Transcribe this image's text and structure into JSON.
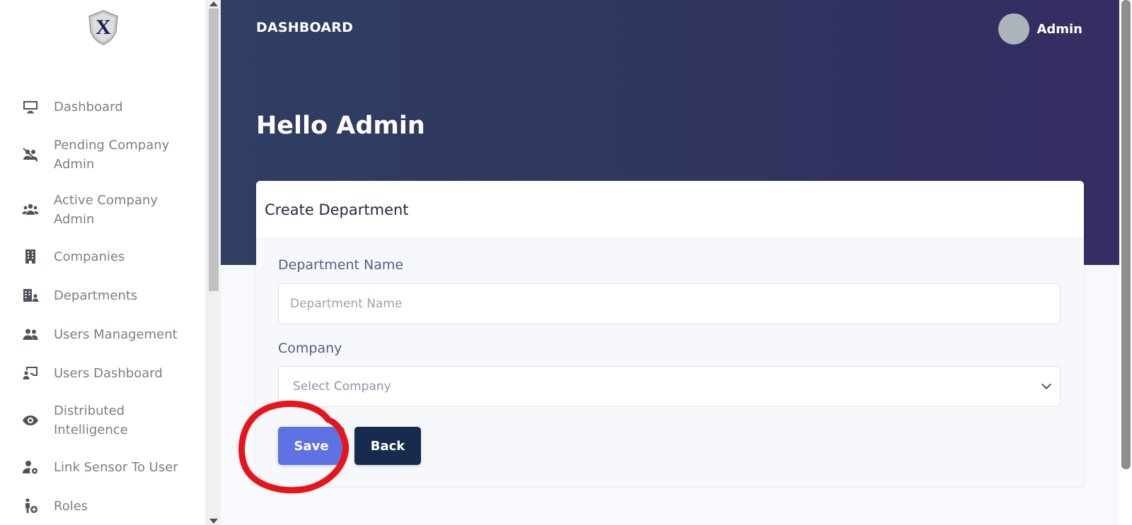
{
  "sidebar": {
    "logo_icon": "shield-x-logo",
    "items": [
      {
        "label": "Dashboard",
        "icon": "monitor-icon"
      },
      {
        "label": "Pending Company Admin",
        "icon": "users-slash-icon"
      },
      {
        "label": "Active Company Admin",
        "icon": "users-icon"
      },
      {
        "label": "Companies",
        "icon": "building-icon"
      },
      {
        "label": "Departments",
        "icon": "building-user-icon"
      },
      {
        "label": "Users Management",
        "icon": "user-group-icon"
      },
      {
        "label": "Users Dashboard",
        "icon": "chalkboard-user-icon"
      },
      {
        "label": "Distributed Intelligence",
        "icon": "eye-icon"
      },
      {
        "label": "Link Sensor To User",
        "icon": "user-gear-icon"
      },
      {
        "label": "Roles",
        "icon": "person-plus-icon"
      }
    ]
  },
  "header": {
    "title": "DASHBOARD",
    "user_name": "Admin",
    "greeting": "Hello Admin"
  },
  "form": {
    "title": "Create Department",
    "department_label": "Department Name",
    "department_placeholder": "Department Name",
    "company_label": "Company",
    "company_placeholder": "Select Company",
    "save_label": "Save",
    "back_label": "Back"
  },
  "colors": {
    "header_gradient_start": "#2f3e62",
    "header_gradient_end": "#342d63",
    "save_button": "#5e72e4",
    "back_button": "#172b4d",
    "annotation_circle": "#e8141b"
  }
}
